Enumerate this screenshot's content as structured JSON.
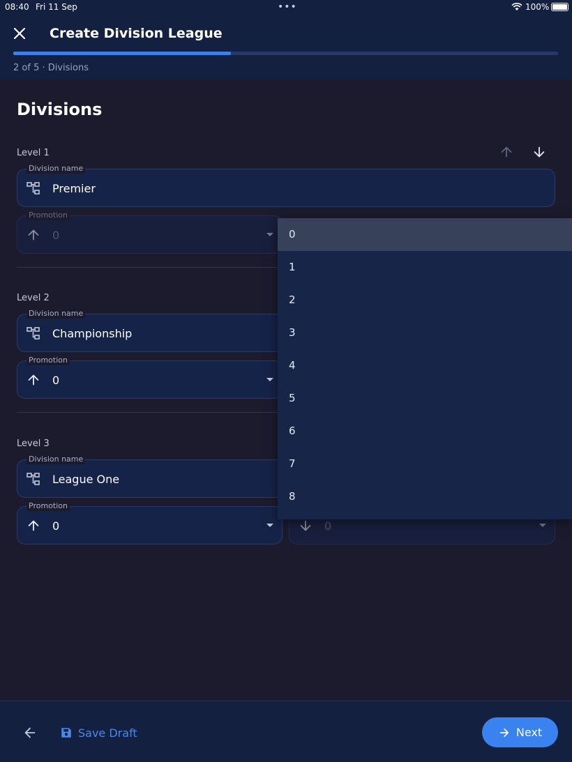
{
  "status_bar": {
    "time": "08:40",
    "date": "Fri 11 Sep",
    "battery": "100%"
  },
  "app_bar": {
    "title": "Create Division League",
    "progress": 0.4,
    "step_label": "2 of 5 · Divisions"
  },
  "section": {
    "title": "Divisions"
  },
  "levels": [
    {
      "label": "Level 1",
      "division_label": "Division name",
      "division_value": "Premier",
      "promotion_label": "Promotion",
      "promotion_value": "0",
      "relegation_value": ""
    },
    {
      "label": "Level 2",
      "division_label": "Division name",
      "division_value": "Championship",
      "promotion_label": "Promotion",
      "promotion_value": "0",
      "relegation_value": ""
    },
    {
      "label": "Level 3",
      "division_label": "Division name",
      "division_value": "League One",
      "promotion_label": "Promotion",
      "promotion_value": "0",
      "relegation_value": "0"
    }
  ],
  "dropdown": {
    "options": [
      "0",
      "1",
      "2",
      "3",
      "4",
      "5",
      "6",
      "7",
      "8"
    ],
    "selected": "0"
  },
  "bottom_bar": {
    "save_draft_label": "Save Draft",
    "next_label": "Next"
  },
  "icons": {
    "close": "close-icon",
    "move_up": "arrow-up-icon",
    "move_down": "arrow-down-icon",
    "division": "hierarchy-icon",
    "promotion": "arrow-up-icon",
    "relegation": "arrow-down-icon",
    "back": "arrow-left-icon",
    "save": "floppy-disk-icon",
    "next": "arrow-right-icon"
  },
  "colors": {
    "accent": "#3a82ef",
    "background": "#1c1b2e",
    "surface": "#162348",
    "bar": "#14203f"
  }
}
